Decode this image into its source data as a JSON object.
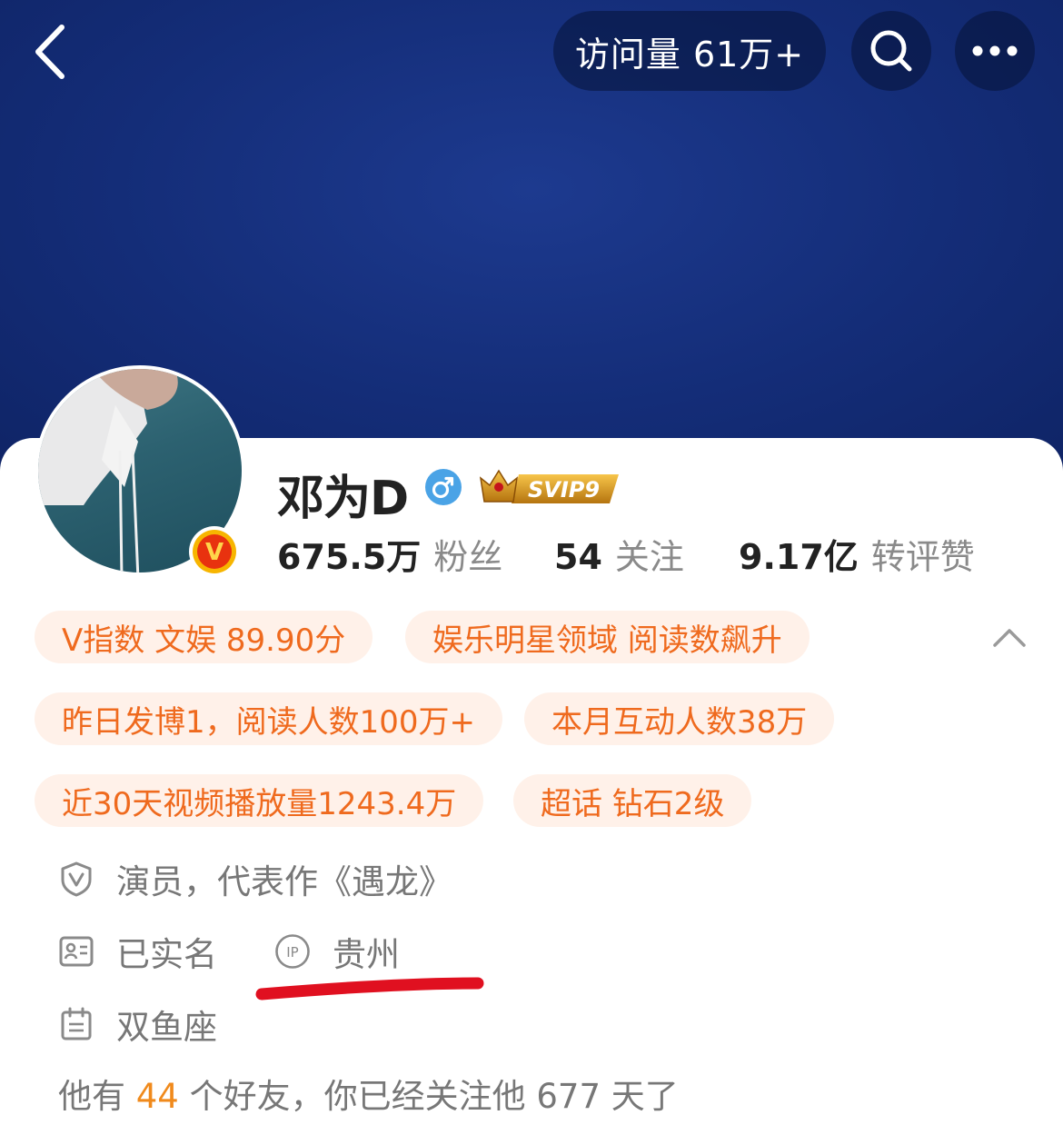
{
  "header": {
    "back_icon": "chevron-left-icon",
    "visits_label": "访问量 61万+",
    "search_icon": "search-icon",
    "more_icon": "more-icon"
  },
  "profile": {
    "name": "邓为D",
    "gender_icon": "male-icon",
    "svip_label": "SVIP9",
    "verified_badge": "V",
    "stats": [
      {
        "value": "675.5万",
        "label": "粉丝"
      },
      {
        "value": "54",
        "label": "关注"
      },
      {
        "value": "9.17亿",
        "label": "转评赞"
      }
    ]
  },
  "tags": [
    "V指数 文娱 89.90分",
    "娱乐明星领域 阅读数飙升",
    "昨日发博1，阅读人数100万+",
    "本月互动人数38万",
    "近30天视频播放量1243.4万",
    "超话 钻石2级"
  ],
  "info": {
    "verification": "演员，代表作《遇龙》",
    "real_name": "已实名",
    "ip_location": "贵州",
    "zodiac": "双鱼座"
  },
  "friends": {
    "prefix": "他有",
    "count": "44",
    "suffix": "个好友，你已经关注他 677 天了"
  },
  "colors": {
    "banner": "#142d78",
    "tag_text": "#ef6a1e",
    "tag_bg": "#fff1e9",
    "friends_count": "#f08a1c",
    "annotation_red": "#e01020",
    "gender_blue": "#4aa3e6"
  }
}
